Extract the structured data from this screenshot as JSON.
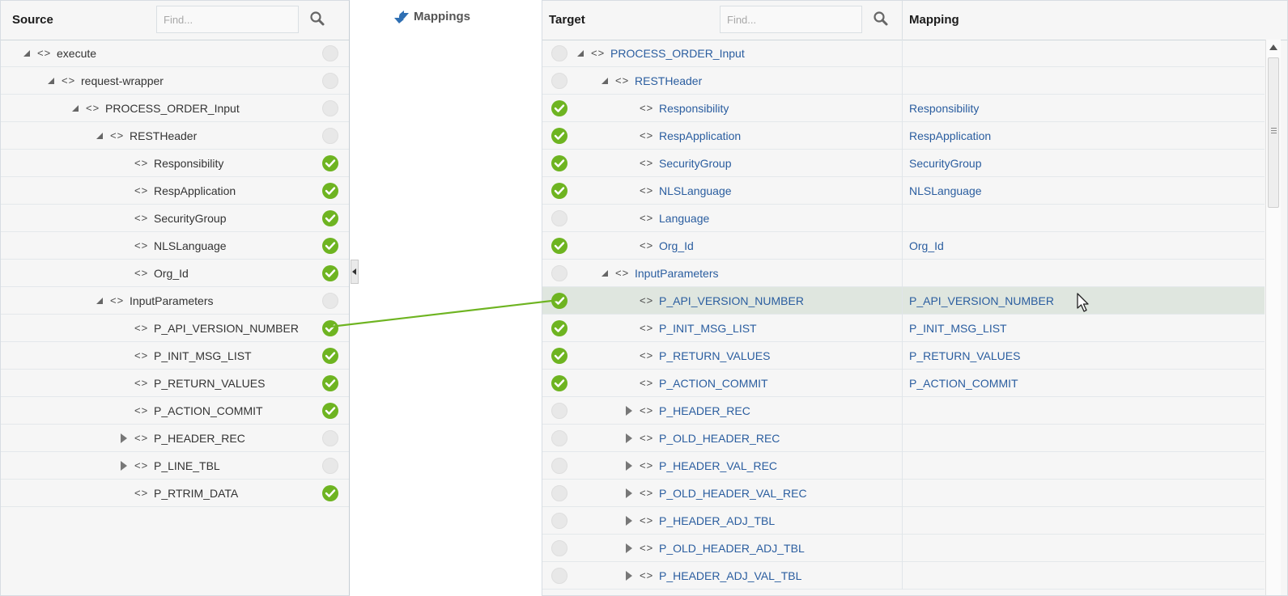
{
  "source": {
    "title": "Source",
    "find_placeholder": "Find...",
    "rows": [
      {
        "label": "execute",
        "toggle": "expanded",
        "status": "unmapped"
      },
      {
        "label": "request-wrapper",
        "toggle": "expanded",
        "status": "unmapped"
      },
      {
        "label": "PROCESS_ORDER_Input",
        "toggle": "expanded",
        "status": "unmapped"
      },
      {
        "label": "RESTHeader",
        "toggle": "expanded",
        "status": "unmapped"
      },
      {
        "label": "Responsibility",
        "toggle": "none",
        "status": "mapped"
      },
      {
        "label": "RespApplication",
        "toggle": "none",
        "status": "mapped"
      },
      {
        "label": "SecurityGroup",
        "toggle": "none",
        "status": "mapped"
      },
      {
        "label": "NLSLanguage",
        "toggle": "none",
        "status": "mapped"
      },
      {
        "label": "Org_Id",
        "toggle": "none",
        "status": "mapped"
      },
      {
        "label": "InputParameters",
        "toggle": "expanded",
        "status": "unmapped"
      },
      {
        "label": "P_API_VERSION_NUMBER",
        "toggle": "none",
        "status": "mapped"
      },
      {
        "label": "P_INIT_MSG_LIST",
        "toggle": "none",
        "status": "mapped"
      },
      {
        "label": "P_RETURN_VALUES",
        "toggle": "none",
        "status": "mapped"
      },
      {
        "label": "P_ACTION_COMMIT",
        "toggle": "none",
        "status": "mapped"
      },
      {
        "label": "P_HEADER_REC",
        "toggle": "collapsed",
        "status": "unmapped"
      },
      {
        "label": "P_LINE_TBL",
        "toggle": "collapsed",
        "status": "unmapped"
      },
      {
        "label": "P_RTRIM_DATA",
        "toggle": "none",
        "status": "mapped"
      }
    ]
  },
  "mappings": {
    "title": "Mappings"
  },
  "target": {
    "title": "Target",
    "find_placeholder": "Find...",
    "mapping_column": "Mapping",
    "rows": [
      {
        "label": "PROCESS_ORDER_Input",
        "toggle": "expanded",
        "status": "unmapped",
        "mapping": ""
      },
      {
        "label": "RESTHeader",
        "toggle": "expanded",
        "status": "unmapped",
        "mapping": ""
      },
      {
        "label": "Responsibility",
        "toggle": "none",
        "status": "mapped",
        "mapping": "Responsibility"
      },
      {
        "label": "RespApplication",
        "toggle": "none",
        "status": "mapped",
        "mapping": "RespApplication"
      },
      {
        "label": "SecurityGroup",
        "toggle": "none",
        "status": "mapped",
        "mapping": "SecurityGroup"
      },
      {
        "label": "NLSLanguage",
        "toggle": "none",
        "status": "mapped",
        "mapping": "NLSLanguage"
      },
      {
        "label": "Language",
        "toggle": "none",
        "status": "unmapped",
        "mapping": ""
      },
      {
        "label": "Org_Id",
        "toggle": "none",
        "status": "mapped",
        "mapping": "Org_Id"
      },
      {
        "label": "InputParameters",
        "toggle": "expanded",
        "status": "unmapped",
        "mapping": ""
      },
      {
        "label": "P_API_VERSION_NUMBER",
        "toggle": "none",
        "status": "mapped",
        "mapping": "P_API_VERSION_NUMBER",
        "selected": true
      },
      {
        "label": "P_INIT_MSG_LIST",
        "toggle": "none",
        "status": "mapped",
        "mapping": "P_INIT_MSG_LIST"
      },
      {
        "label": "P_RETURN_VALUES",
        "toggle": "none",
        "status": "mapped",
        "mapping": "P_RETURN_VALUES"
      },
      {
        "label": "P_ACTION_COMMIT",
        "toggle": "none",
        "status": "mapped",
        "mapping": "P_ACTION_COMMIT"
      },
      {
        "label": "P_HEADER_REC",
        "toggle": "collapsed",
        "status": "unmapped",
        "mapping": ""
      },
      {
        "label": "P_OLD_HEADER_REC",
        "toggle": "collapsed",
        "status": "unmapped",
        "mapping": ""
      },
      {
        "label": "P_HEADER_VAL_REC",
        "toggle": "collapsed",
        "status": "unmapped",
        "mapping": ""
      },
      {
        "label": "P_OLD_HEADER_VAL_REC",
        "toggle": "collapsed",
        "status": "unmapped",
        "mapping": ""
      },
      {
        "label": "P_HEADER_ADJ_TBL",
        "toggle": "collapsed",
        "status": "unmapped",
        "mapping": ""
      },
      {
        "label": "P_OLD_HEADER_ADJ_TBL",
        "toggle": "collapsed",
        "status": "unmapped",
        "mapping": ""
      },
      {
        "label": "P_HEADER_ADJ_VAL_TBL",
        "toggle": "collapsed",
        "status": "unmapped",
        "mapping": ""
      }
    ]
  },
  "colors": {
    "mapped": "#6eb421",
    "link_text": "#2a5d9f",
    "selected_row": "#dfe6df",
    "connector": "#6eb421"
  }
}
